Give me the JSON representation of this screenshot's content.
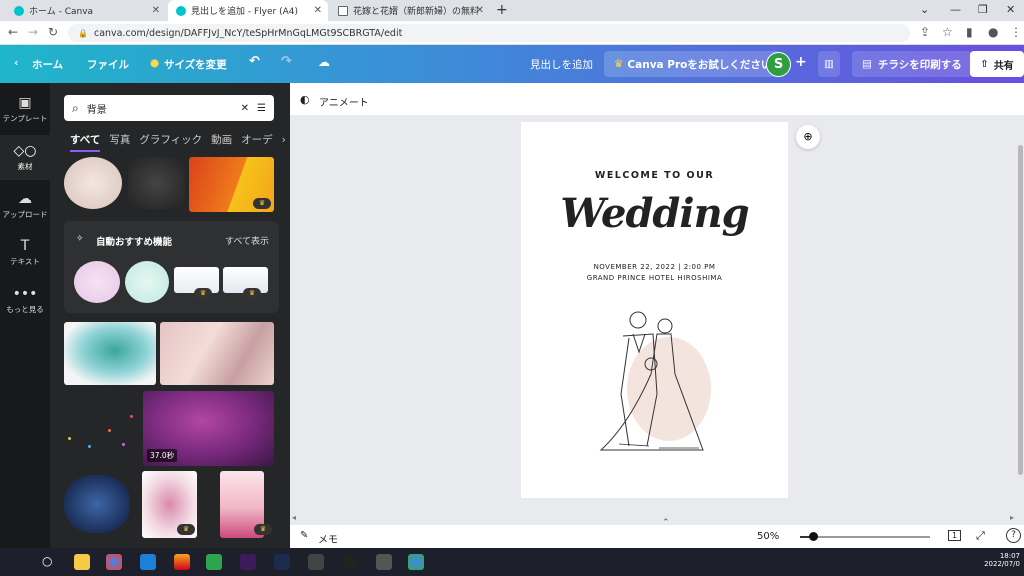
{
  "browser": {
    "tabs": [
      {
        "title": "ホーム - Canva"
      },
      {
        "title": "見出しを追加 - Flyer (A4)"
      },
      {
        "title": "花嫁と花婿（新郎新婦）の無料イ"
      }
    ],
    "url": "canva.com/design/DAFFJvJ_NcY/teSpHrMnGqLMGt9SCBRGTA/edit"
  },
  "toolbar": {
    "home": "ホーム",
    "file": "ファイル",
    "resize": "サイズを変更",
    "doc_title": "見出しを追加",
    "pro_trial": "Canva Proをお試しください",
    "avatar_letter": "S",
    "print": "チラシを印刷する",
    "share": "共有"
  },
  "rail": {
    "items": [
      {
        "label": "テンプレート"
      },
      {
        "label": "素材"
      },
      {
        "label": "アップロード"
      },
      {
        "label": "テキスト"
      },
      {
        "label": "もっと見る"
      }
    ]
  },
  "panel": {
    "search_value": "背景",
    "filter_tabs": [
      "すべて",
      "写真",
      "グラフィック",
      "動画",
      "オーデ"
    ],
    "recommend_title": "自動おすすめ機能",
    "see_all": "すべて表示",
    "video_duration": "37.0秒"
  },
  "canvas": {
    "animate": "アニメート",
    "flyer": {
      "welcome": "WELCOME TO OUR",
      "headline": "Wedding",
      "date_line": "NOVEMBER 22, 2022 | 2:00 PM",
      "venue": "GRAND PRINCE HOTEL HIROSHIMA"
    }
  },
  "bottom": {
    "notes": "メモ",
    "zoom": "50%",
    "page_count": "1",
    "zoom_fraction": 0.5
  },
  "taskbar": {
    "clock_time": "18:07",
    "clock_date": "2022/07/0"
  },
  "colors": {
    "brand_gradient_start": "#1fb6c9",
    "brand_gradient_end": "#6a4fe0",
    "panel_bg": "#252627",
    "rail_bg": "#18191b",
    "avatar": "#2e9e3e"
  }
}
